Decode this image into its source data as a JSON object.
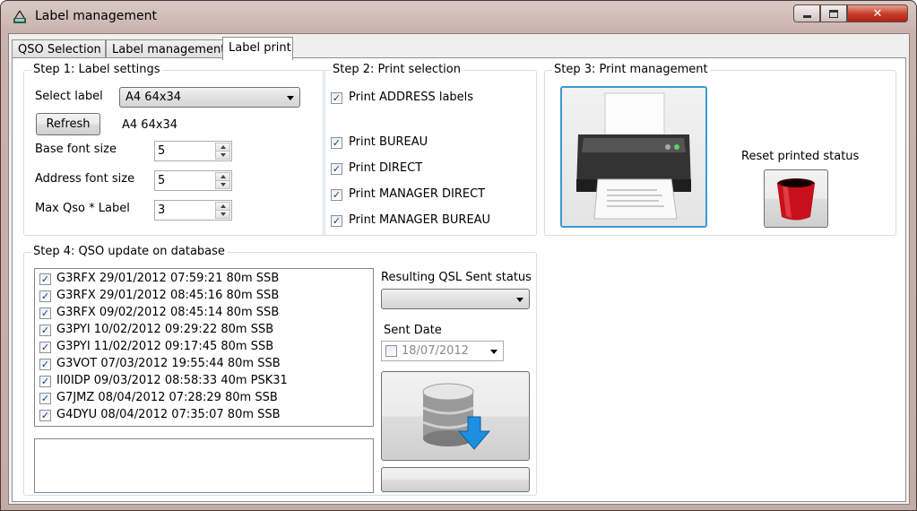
{
  "window": {
    "title": "Label management"
  },
  "tabs": [
    {
      "label": "QSO Selection"
    },
    {
      "label": "Label management"
    },
    {
      "label": "Label print"
    }
  ],
  "step1": {
    "title": "Step 1: Label settings",
    "select_label": "Select label",
    "selected_label": "A4 64x34",
    "refresh_button": "Refresh",
    "current_label": "A4 64x34",
    "base_font_size_label": "Base font size",
    "base_font_size": "5",
    "address_font_size_label": "Address font size",
    "address_font_size": "5",
    "max_qso_label": "Max Qso * Label",
    "max_qso": "3"
  },
  "step2": {
    "title": "Step 2: Print selection",
    "print_address": "Print ADDRESS labels",
    "print_bureau": "Print BUREAU",
    "print_direct": "Print DIRECT",
    "print_manager_direct": "Print MANAGER DIRECT",
    "print_manager_bureau": "Print MANAGER BUREAU"
  },
  "step3": {
    "title": "Step 3: Print management",
    "reset_label": "Reset printed status"
  },
  "step4": {
    "title": "Step 4: QSO update on database",
    "qsos": [
      {
        "text": "G3RFX 29/01/2012 07:59:21 80m SSB",
        "checked": true
      },
      {
        "text": "G3RFX 29/01/2012 08:45:16 80m SSB",
        "checked": true
      },
      {
        "text": "G3RFX 09/02/2012 08:45:14 80m SSB",
        "checked": true
      },
      {
        "text": "G3PYI 10/02/2012 09:29:22 80m SSB",
        "checked": true
      },
      {
        "text": "G3PYI 11/02/2012 09:17:45 80m SSB",
        "checked": true
      },
      {
        "text": "G3VOT 07/03/2012 19:55:44 80m SSB",
        "checked": true
      },
      {
        "text": "II0IDP 09/03/2012 08:58:33 40m PSK31",
        "checked": true
      },
      {
        "text": "G7JMZ 08/04/2012 07:28:29 80m SSB",
        "checked": true
      },
      {
        "text": "G4DYU 08/04/2012 07:35:07 80m SSB",
        "checked": true
      }
    ],
    "qsl_status_label": "Resulting QSL Sent status",
    "qsl_status_value": "",
    "sent_date_label": "Sent Date",
    "sent_date": "18/07/2012"
  },
  "icons": {
    "app": "antenna-icon",
    "printer": "printer-icon",
    "reset": "red-bin-icon",
    "db": "database-download-icon"
  },
  "colors": {
    "title_bar": "#cab2ad",
    "close_button": "#c43b25",
    "focus_border": "#3c9ad2",
    "reset_bin": "#c8101a",
    "db_arrow": "#1d8fe0"
  }
}
